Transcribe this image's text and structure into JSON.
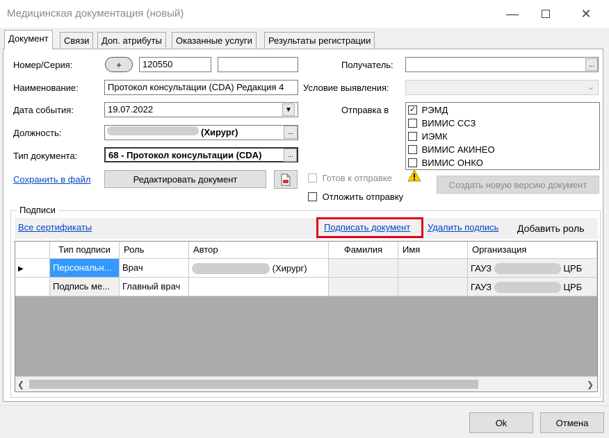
{
  "window": {
    "title": "Медицинская документация (новый)"
  },
  "tabs": [
    {
      "label": "Документ"
    },
    {
      "label": "Связи"
    },
    {
      "label": "Доп. атрибуты"
    },
    {
      "label": "Оказанные услуги"
    },
    {
      "label": "Результаты регистрации"
    }
  ],
  "form": {
    "number_label": "Номер/Серия:",
    "plus_label": "+",
    "number_value": "120550",
    "series_value": "",
    "name_label": "Наименование:",
    "name_value": "Протокол консультации (CDA) Редакция 4",
    "date_label": "Дата события:",
    "date_value": "19.07.2022",
    "position_label": "Должность:",
    "position_value": "(Хирург)",
    "doctype_label": "Тип документа:",
    "doctype_value": "68 - Протокол консультации (CDA)",
    "save_to_file": "Сохранить в файл",
    "edit_document": "Редактировать документ",
    "ellipsis": "..."
  },
  "right": {
    "recipient_label": "Получатель:",
    "condition_label": "Условие выявления:",
    "send_to_label": "Отправка в",
    "send_options": [
      {
        "label": "РЭМД",
        "checked": true
      },
      {
        "label": "ВИМИС ССЗ",
        "checked": false
      },
      {
        "label": "ИЭМК",
        "checked": false
      },
      {
        "label": "ВИМИС АКИНЕО",
        "checked": false
      },
      {
        "label": "ВИМИС ОНКО",
        "checked": false
      }
    ],
    "ready_label": "Готов к отправке",
    "postpone_label": "Отложить отправку",
    "new_version": "Создать новую версию документ"
  },
  "signatures": {
    "group_label": "Подписи",
    "all_certs": "Все сертификаты",
    "sign_document": "Подписать документ",
    "delete_signature": "Удалить подпись",
    "add_role": "Добавить роль",
    "columns": [
      "Тип подписи",
      "Роль",
      "Автор",
      "Фамилия",
      "Имя",
      "Организация"
    ],
    "rows": [
      {
        "type": "Персональн...",
        "role": "Врач",
        "author": "(Хирург)",
        "surname": "",
        "name": "",
        "org_prefix": "ГАУЗ",
        "org_suffix": "ЦРБ"
      },
      {
        "type": "Подпись ме...",
        "role": "Главный врач",
        "author": "",
        "surname": "",
        "name": "",
        "org_prefix": "ГАУЗ",
        "org_suffix": "ЦРБ"
      }
    ]
  },
  "footer": {
    "ok": "Ok",
    "cancel": "Отмена"
  },
  "colors": {
    "highlight_red": "#e0001b",
    "link_blue": "#0645c5",
    "selection": "#3399ff"
  },
  "icons": [
    "minimize-icon",
    "maximize-icon",
    "close-icon",
    "dropdown-arrow-icon",
    "ellipsis-icon",
    "document-save-icon",
    "warning-icon",
    "row-pointer-icon",
    "scroll-left-icon",
    "scroll-right-icon"
  ]
}
